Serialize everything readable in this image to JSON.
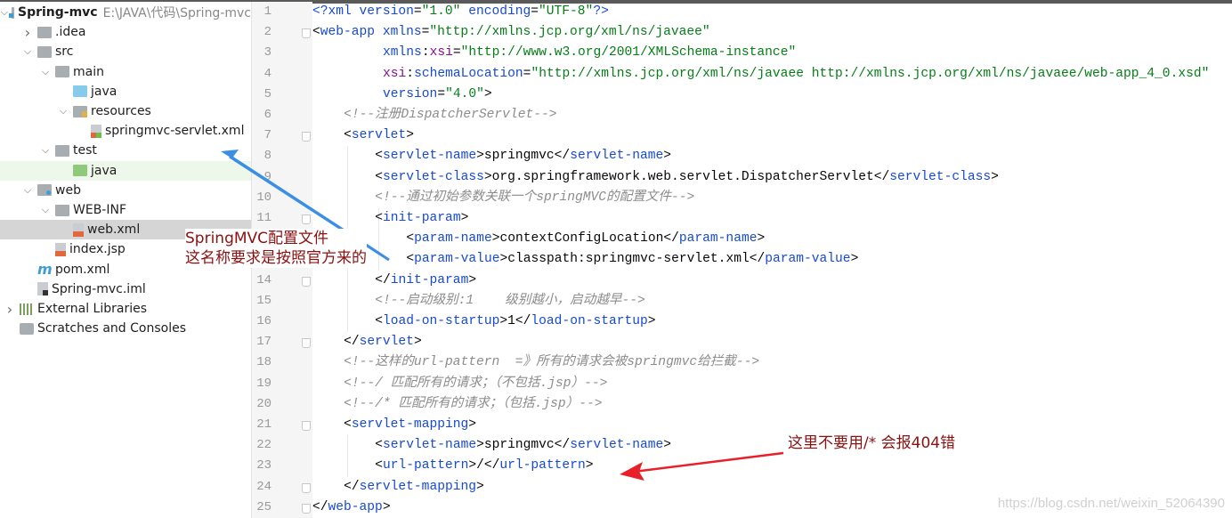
{
  "project_tree": [
    {
      "label": "Spring-mvc",
      "path": "E:\\JAVA\\代码\\Spring-mvc",
      "icon": "module-folder-icon",
      "depth": 0,
      "expanded": true,
      "bold": true
    },
    {
      "label": ".idea",
      "icon": "folder-icon",
      "depth": 1,
      "expanded": false
    },
    {
      "label": "src",
      "icon": "folder-icon",
      "depth": 1,
      "expanded": true
    },
    {
      "label": "main",
      "icon": "folder-icon",
      "depth": 2,
      "expanded": true
    },
    {
      "label": "java",
      "icon": "source-folder-icon",
      "depth": 3
    },
    {
      "label": "resources",
      "icon": "resources-folder-icon",
      "depth": 3,
      "expanded": true
    },
    {
      "label": "springmvc-servlet.xml",
      "icon": "spring-xml-file-icon",
      "depth": 4
    },
    {
      "label": "test",
      "icon": "folder-icon",
      "depth": 2,
      "expanded": true
    },
    {
      "label": "java",
      "icon": "test-folder-icon",
      "depth": 3,
      "highlighted": true
    },
    {
      "label": "web",
      "icon": "web-folder-icon",
      "depth": 1,
      "expanded": true
    },
    {
      "label": "WEB-INF",
      "icon": "folder-icon",
      "depth": 2,
      "expanded": true
    },
    {
      "label": "web.xml",
      "icon": "xml-file-icon",
      "depth": 3,
      "selected": true
    },
    {
      "label": "index.jsp",
      "icon": "jsp-file-icon",
      "depth": 2
    },
    {
      "label": "pom.xml",
      "icon": "maven-icon",
      "depth": 1
    },
    {
      "label": "Spring-mvc.iml",
      "icon": "iml-file-icon",
      "depth": 1
    },
    {
      "label": "External Libraries",
      "icon": "libraries-icon",
      "depth": 0,
      "expanded": false
    },
    {
      "label": "Scratches and Consoles",
      "icon": "scratches-icon",
      "depth": 0
    }
  ],
  "editor": {
    "lines": [
      {
        "indent": 0,
        "tokens": [
          [
            "tag",
            "<?xml "
          ],
          [
            "attr",
            "version"
          ],
          [
            "txt",
            "="
          ],
          [
            "val",
            "\"1.0\""
          ],
          [
            "txt",
            " "
          ],
          [
            "attr",
            "encoding"
          ],
          [
            "txt",
            "="
          ],
          [
            "val",
            "\"UTF-8\""
          ],
          [
            "tag",
            "?>"
          ]
        ]
      },
      {
        "indent": 0,
        "fold": true,
        "tokens": [
          [
            "txt",
            "<"
          ],
          [
            "tag",
            "web-app "
          ],
          [
            "attr",
            "xmlns"
          ],
          [
            "txt",
            "="
          ],
          [
            "val",
            "\"http://xmlns.jcp.org/xml/ns/javaee\""
          ]
        ]
      },
      {
        "indent": 9,
        "tokens": [
          [
            "attr",
            "xmlns"
          ],
          [
            "txt",
            ":"
          ],
          [
            "ns",
            "xsi"
          ],
          [
            "txt",
            "="
          ],
          [
            "val",
            "\"http://www.w3.org/2001/XMLSchema-instance\""
          ]
        ]
      },
      {
        "indent": 9,
        "tokens": [
          [
            "ns",
            "xsi"
          ],
          [
            "txt",
            ":"
          ],
          [
            "attr",
            "schemaLocation"
          ],
          [
            "txt",
            "="
          ],
          [
            "val",
            "\"http://xmlns.jcp.org/xml/ns/javaee http://xmlns.jcp.org/xml/ns/javaee/web-app_4_0.xsd\""
          ]
        ]
      },
      {
        "indent": 9,
        "tokens": [
          [
            "attr",
            "version"
          ],
          [
            "txt",
            "="
          ],
          [
            "val",
            "\"4.0\""
          ],
          [
            "txt",
            ">"
          ]
        ]
      },
      {
        "indent": 4,
        "tokens": [
          [
            "cmt",
            "<!--注册DispatcherServlet-->"
          ]
        ]
      },
      {
        "indent": 4,
        "fold": true,
        "tokens": [
          [
            "txt",
            "<"
          ],
          [
            "tag",
            "servlet"
          ],
          [
            "txt",
            ">"
          ]
        ]
      },
      {
        "indent": 8,
        "tokens": [
          [
            "txt",
            "<"
          ],
          [
            "tag",
            "servlet-name"
          ],
          [
            "txt",
            ">springmvc</"
          ],
          [
            "tag",
            "servlet-name"
          ],
          [
            "txt",
            ">"
          ]
        ]
      },
      {
        "indent": 8,
        "tokens": [
          [
            "txt",
            "<"
          ],
          [
            "tag",
            "servlet-class"
          ],
          [
            "txt",
            ">org.springframework.web.servlet.DispatcherServlet</"
          ],
          [
            "tag",
            "servlet-class"
          ],
          [
            "txt",
            ">"
          ]
        ]
      },
      {
        "indent": 8,
        "tokens": [
          [
            "cmt",
            "<!--通过初始参数关联一个springMVC的配置文件-->"
          ]
        ]
      },
      {
        "indent": 8,
        "fold": true,
        "tokens": [
          [
            "txt",
            "<"
          ],
          [
            "tag",
            "init-param"
          ],
          [
            "txt",
            ">"
          ]
        ]
      },
      {
        "indent": 12,
        "tokens": [
          [
            "txt",
            "<"
          ],
          [
            "tag",
            "param-name"
          ],
          [
            "txt",
            ">contextConfigLocation</"
          ],
          [
            "tag",
            "param-name"
          ],
          [
            "txt",
            ">"
          ]
        ]
      },
      {
        "indent": 12,
        "tokens": [
          [
            "txt",
            "<"
          ],
          [
            "tag",
            "param-value"
          ],
          [
            "txt",
            ">classpath:springmvc-servlet.xml</"
          ],
          [
            "tag",
            "param-value"
          ],
          [
            "txt",
            ">"
          ]
        ]
      },
      {
        "indent": 8,
        "fold": true,
        "tokens": [
          [
            "txt",
            "</"
          ],
          [
            "tag",
            "init-param"
          ],
          [
            "txt",
            ">"
          ]
        ]
      },
      {
        "indent": 8,
        "tokens": [
          [
            "cmt",
            "<!--启动级别:1    级别越小，启动越早-->"
          ]
        ]
      },
      {
        "indent": 8,
        "tokens": [
          [
            "txt",
            "<"
          ],
          [
            "tag",
            "load-on-startup"
          ],
          [
            "txt",
            ">1</"
          ],
          [
            "tag",
            "load-on-startup"
          ],
          [
            "txt",
            ">"
          ]
        ]
      },
      {
        "indent": 4,
        "fold": true,
        "tokens": [
          [
            "txt",
            "</"
          ],
          [
            "tag",
            "servlet"
          ],
          [
            "txt",
            ">"
          ]
        ]
      },
      {
        "indent": 4,
        "tokens": [
          [
            "cmt",
            "<!--这样的url-pattern  =》所有的请求会被springmvc给拦截-->"
          ]
        ]
      },
      {
        "indent": 4,
        "tokens": [
          [
            "cmt",
            "<!--/ 匹配所有的请求；（不包括.jsp）-->"
          ]
        ]
      },
      {
        "indent": 4,
        "tokens": [
          [
            "cmt",
            "<!--/* 匹配所有的请求；（包括.jsp）-->"
          ]
        ]
      },
      {
        "indent": 4,
        "fold": true,
        "tokens": [
          [
            "txt",
            "<"
          ],
          [
            "tag",
            "servlet-mapping"
          ],
          [
            "txt",
            ">"
          ]
        ]
      },
      {
        "indent": 8,
        "tokens": [
          [
            "txt",
            "<"
          ],
          [
            "tag",
            "servlet-name"
          ],
          [
            "txt",
            ">springmvc</"
          ],
          [
            "tag",
            "servlet-name"
          ],
          [
            "txt",
            ">"
          ]
        ]
      },
      {
        "indent": 8,
        "tokens": [
          [
            "txt",
            "<"
          ],
          [
            "tag",
            "url-pattern"
          ],
          [
            "txt",
            ">/</"
          ],
          [
            "tag",
            "url-pattern"
          ],
          [
            "txt",
            ">"
          ]
        ]
      },
      {
        "indent": 4,
        "fold": true,
        "tokens": [
          [
            "txt",
            "</"
          ],
          [
            "tag",
            "servlet-mapping"
          ],
          [
            "txt",
            ">"
          ]
        ]
      },
      {
        "indent": 0,
        "fold": true,
        "tokens": [
          [
            "txt",
            "</"
          ],
          [
            "tag",
            "web-app"
          ],
          [
            "txt",
            ">"
          ]
        ]
      }
    ]
  },
  "annotations": {
    "config_note_line1": "SpringMVC配置文件",
    "config_note_line2": "这名称要求是按照官方来的",
    "url_note": "这里不要用/* 会报404错"
  },
  "watermark": "https://blog.csdn.net/weixin_52064390",
  "colors": {
    "tag": "#174ad4",
    "value": "#067d17",
    "namespace": "#871094",
    "comment": "#8c8c8c",
    "annotation": "#8b1010",
    "blue_arrow": "#3a8ee6",
    "red_arrow": "#e8202a"
  }
}
